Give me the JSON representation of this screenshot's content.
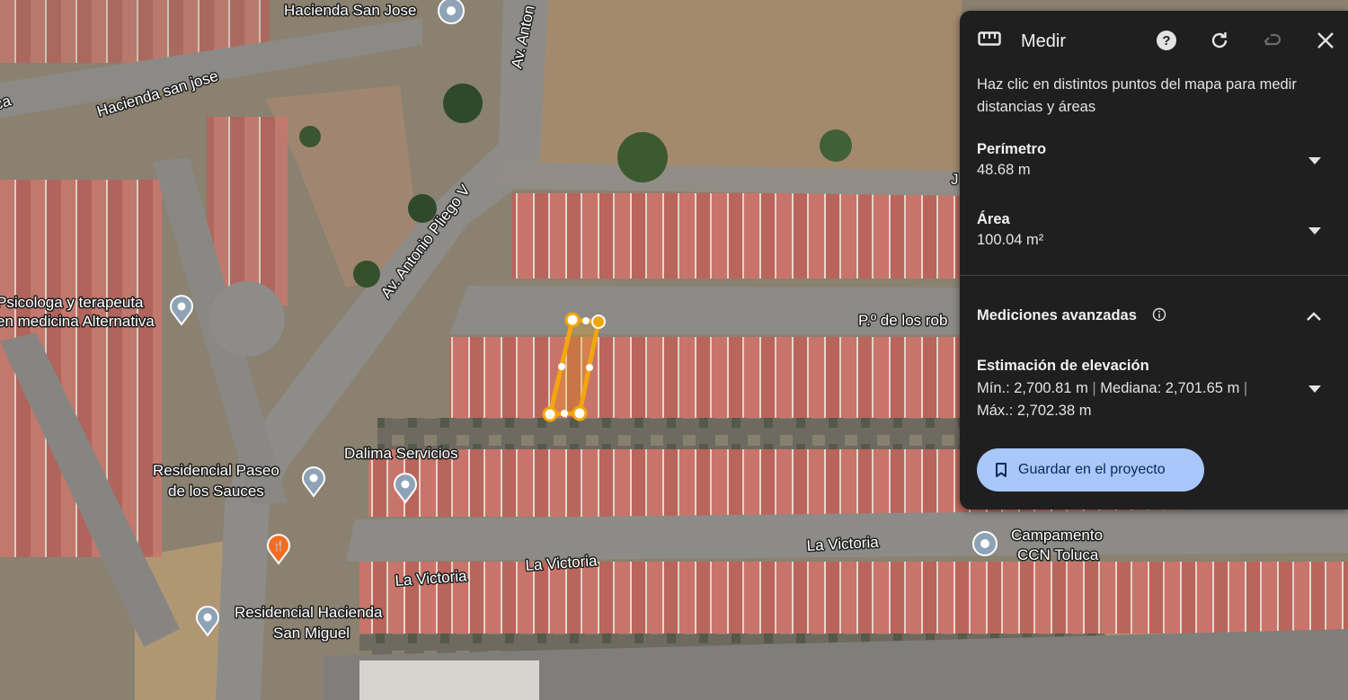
{
  "map": {
    "places": [
      {
        "name": "Hacienda San Jose"
      },
      {
        "name1": "Psicologa y terapeuta",
        "name2": "en medicina Alternativa"
      },
      {
        "name": "Dalima Servicios"
      },
      {
        "name1": "Residencial Paseo",
        "name2": "de los Sauces"
      },
      {
        "name1": "Residencial Hacienda",
        "name2": "San Miguel"
      },
      {
        "name1": "Campamento",
        "name2": "CCN Toluca"
      }
    ],
    "roads": {
      "hacienda_sj": "Hacienda san jose",
      "antonio_pliego": "Av. Antonio Pliego V",
      "antonio_top": "Av. Anton",
      "robles": "P.º de los rob",
      "victoria1": "La Victoria",
      "victoria2": "La Victoria",
      "victoria3": "La Victoria",
      "ca_left": "ca",
      "j_right": "J"
    },
    "colors": {
      "measure_line": "#f2a60c",
      "pin": "#8fa3b7",
      "food_pin": "#f26d21"
    }
  },
  "panel": {
    "title": "Medir",
    "description": "Haz clic en distintos puntos del mapa para medir distancias y áreas",
    "perimeter": {
      "label": "Perímetro",
      "value": "48.68 m"
    },
    "area": {
      "label": "Área",
      "value": "100.04 m²"
    },
    "advanced": {
      "label": "Mediciones avanzadas"
    },
    "elevation": {
      "label": "Estimación de elevación",
      "min": "Mín.: 2,700.81 m",
      "median": "Mediana: 2,701.65 m",
      "max": "Máx.: 2,702.38 m"
    },
    "save_label": "Guardar en el proyecto",
    "icons": [
      "ruler-icon",
      "help-icon",
      "refresh-icon",
      "undo-icon",
      "close-icon",
      "chevron-down-icon",
      "chevron-up-icon",
      "info-icon",
      "bookmark-icon"
    ]
  }
}
